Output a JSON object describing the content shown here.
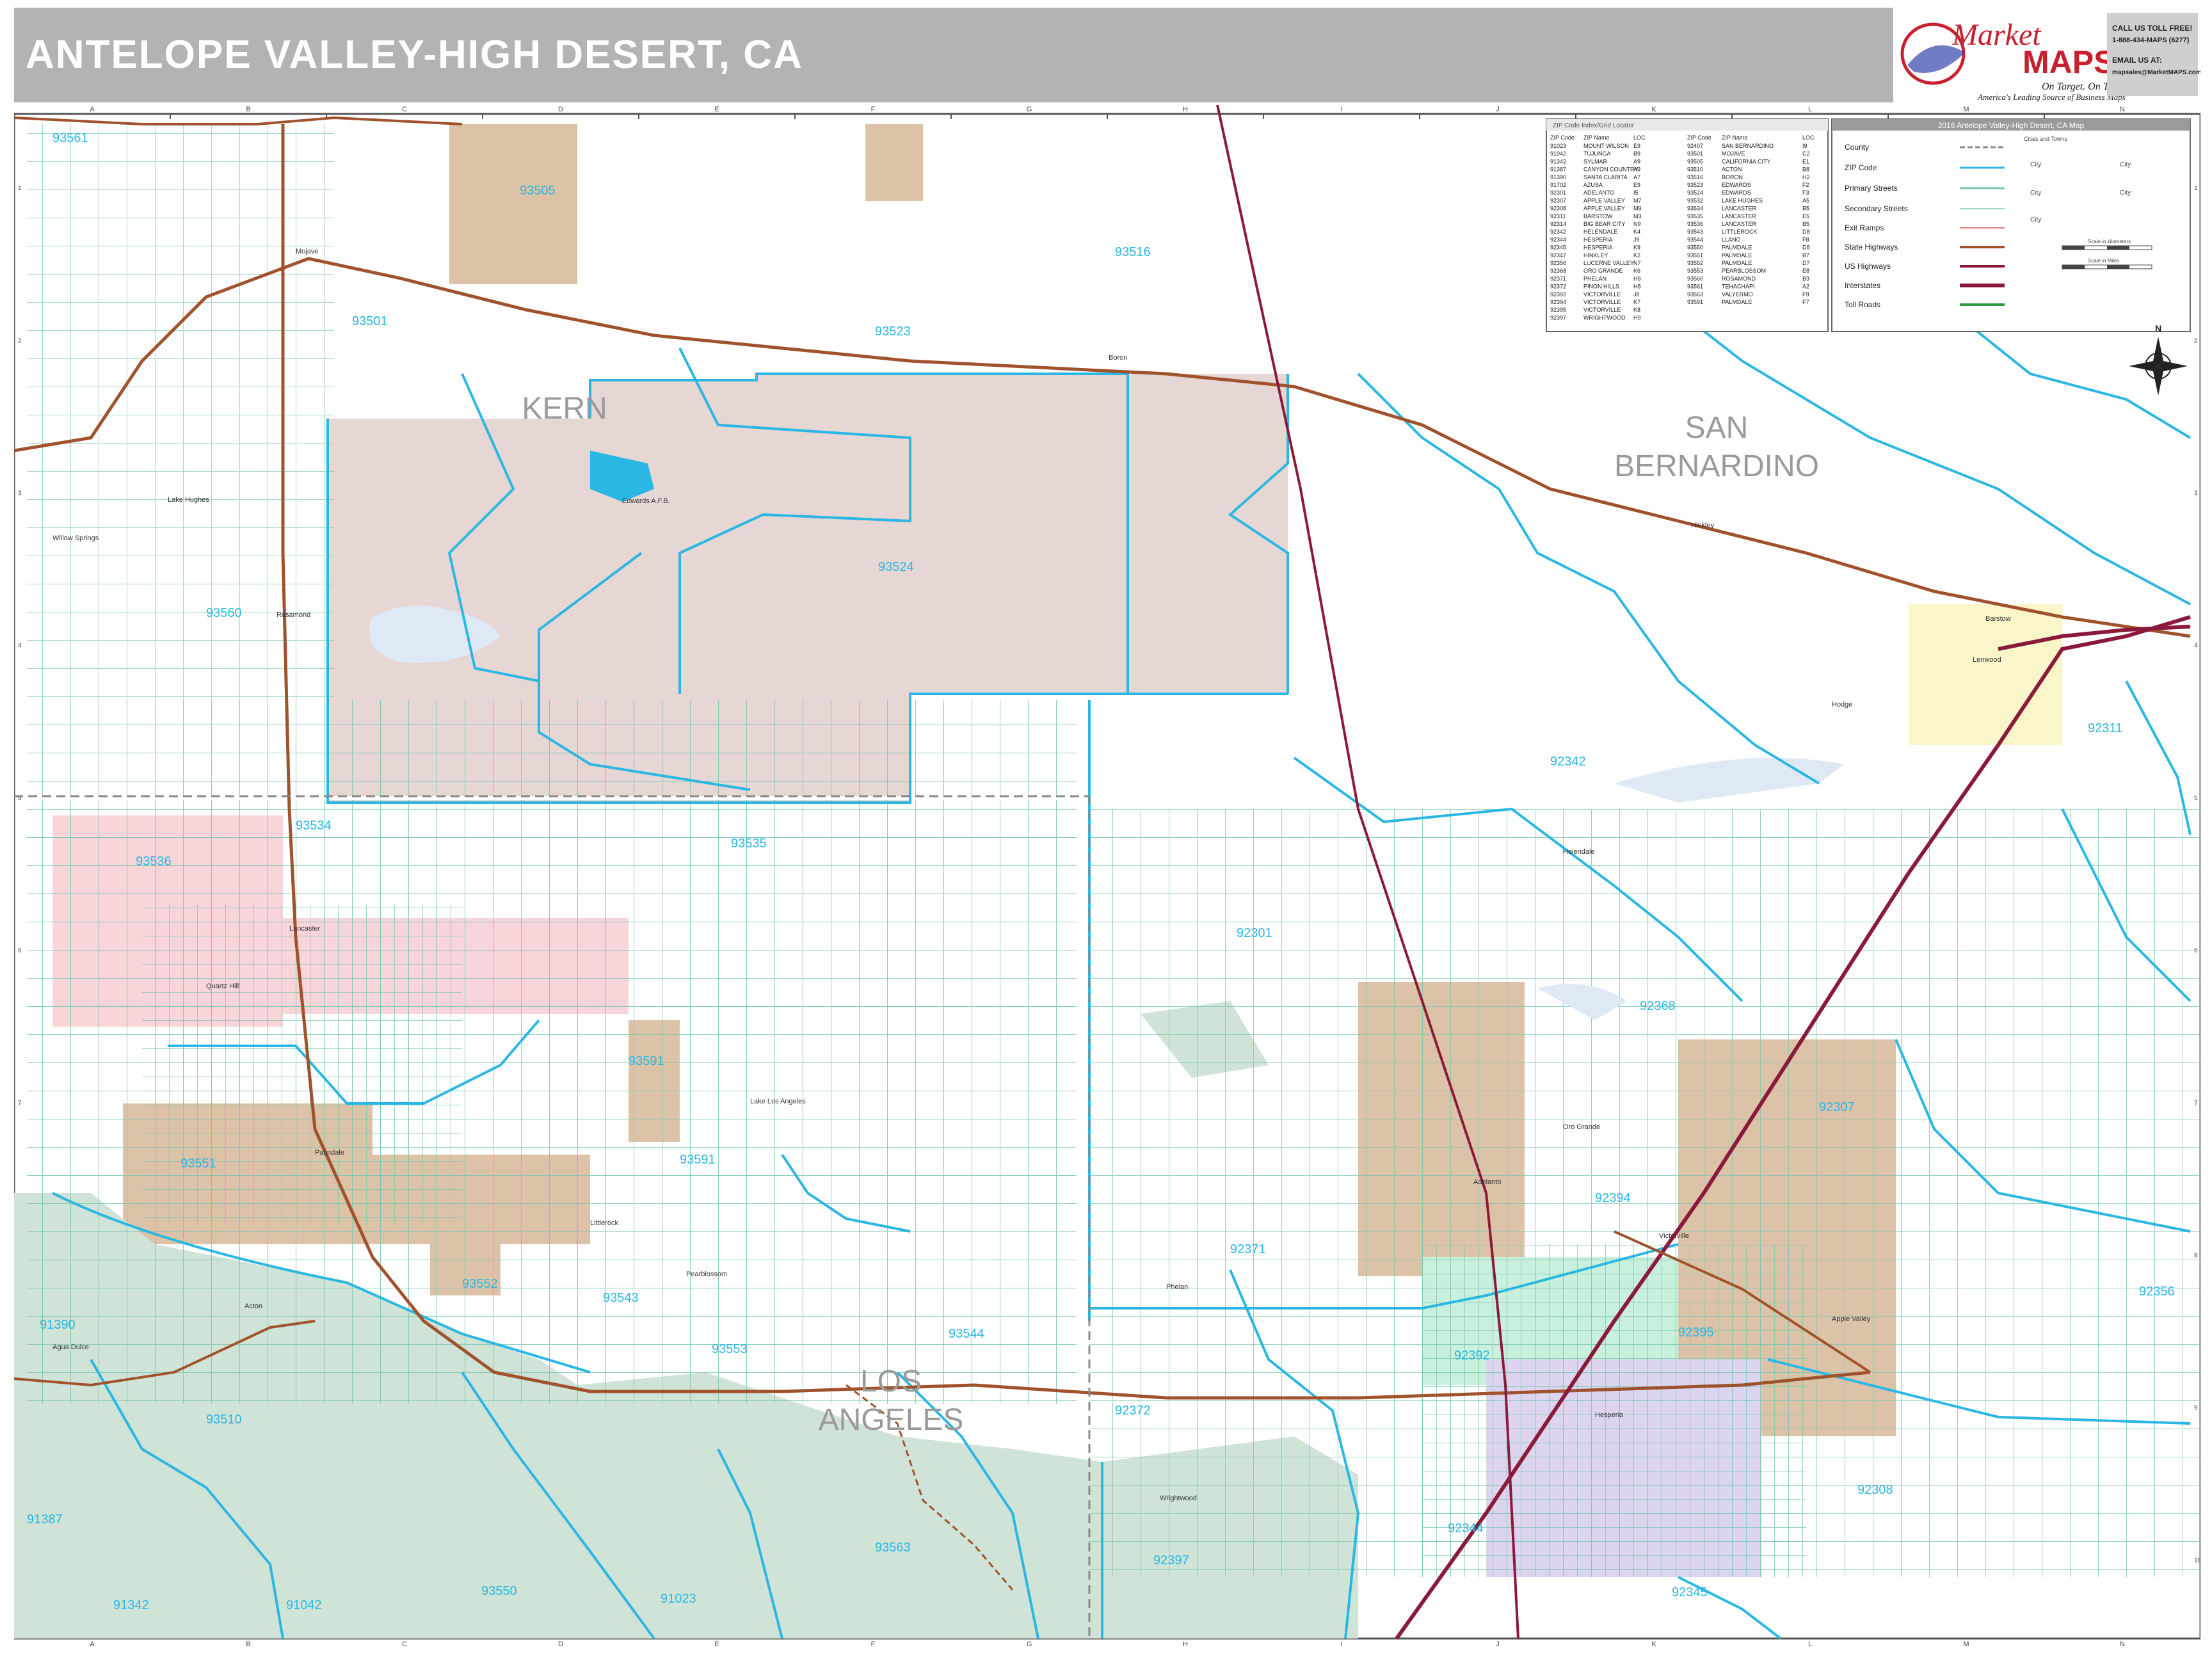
{
  "header": {
    "title": "ANTELOPE VALLEY-HIGH DESERT, CA"
  },
  "brand": {
    "logo_word1": "Market",
    "logo_word2": "MAPS",
    "tagline": "On Target. On Time.",
    "subtitle": "America's Leading Source of Business Maps",
    "call_label": "CALL US TOLL FREE!",
    "phone": "1-888-434-MAPS (6277)",
    "email_label": "EMAIL US AT:",
    "email": "mapsales@MarketMAPS.com"
  },
  "colors": {
    "zip_boundary": "#2bb7e3",
    "street": "#7cc7b2",
    "highway": "#a0522d",
    "interstate": "#8b1a3a",
    "kern_fill": "#e6d6d4",
    "lancaster_fill": "#f7d5d8",
    "tan_fill": "#dcc3a8",
    "green_fill": "#cfe3d6",
    "purple_fill": "#ddd5f0",
    "yellow_fill": "#fbf6c9",
    "mint_fill": "#c8f0dc"
  },
  "grid": {
    "cols": [
      "A",
      "B",
      "C",
      "D",
      "E",
      "F",
      "G",
      "H",
      "I",
      "J",
      "K",
      "L",
      "M",
      "N"
    ],
    "rows": [
      "1",
      "2",
      "3",
      "4",
      "5",
      "6",
      "7",
      "8",
      "9",
      "10"
    ]
  },
  "zip_index": {
    "title": "ZIP Code Index/Grid Locator",
    "headers": [
      "ZIP Code",
      "ZIP Name",
      "LOC",
      "ZIP Code",
      "ZIP Name",
      "LOC"
    ],
    "rows": [
      [
        "91023",
        "MOUNT WILSON",
        "E9",
        "92407",
        "SAN BERNARDINO",
        "I9"
      ],
      [
        "91042",
        "TUJUNGA",
        "B9",
        "93501",
        "MOJAVE",
        "C2"
      ],
      [
        "91342",
        "SYLMAR",
        "A9",
        "93505",
        "CALIFORNIA CITY",
        "E1"
      ],
      [
        "91387",
        "CANYON COUNTRY",
        "A9",
        "93510",
        "ACTON",
        "B8"
      ],
      [
        "91390",
        "SANTA CLARITA",
        "A7",
        "93516",
        "BORON",
        "H2"
      ],
      [
        "91702",
        "AZUSA",
        "E9",
        "93523",
        "EDWARDS",
        "F2"
      ],
      [
        "92301",
        "ADELANTO",
        "I5",
        "93524",
        "EDWARDS",
        "F3"
      ],
      [
        "92307",
        "APPLE VALLEY",
        "M7",
        "93532",
        "LAKE HUGHES",
        "A5"
      ],
      [
        "92308",
        "APPLE VALLEY",
        "M9",
        "93534",
        "LANCASTER",
        "B5"
      ],
      [
        "92311",
        "BARSTOW",
        "M3",
        "93535",
        "LANCASTER",
        "E5"
      ],
      [
        "92314",
        "BIG BEAR CITY",
        "N9",
        "93536",
        "LANCASTER",
        "B5"
      ],
      [
        "92342",
        "HELENDALE",
        "K4",
        "93543",
        "LITTLEROCK",
        "D8"
      ],
      [
        "92344",
        "HESPERIA",
        "J9",
        "93544",
        "LLANO",
        "F8"
      ],
      [
        "92345",
        "HESPERIA",
        "K9",
        "93550",
        "PALMDALE",
        "D8"
      ],
      [
        "92347",
        "HINKLEY",
        "K2",
        "93551",
        "PALMDALE",
        "B7"
      ],
      [
        "92356",
        "LUCERNE VALLEY",
        "N7",
        "93552",
        "PALMDALE",
        "D7"
      ],
      [
        "92368",
        "ORO GRANDE",
        "K6",
        "93553",
        "PEARBLOSSOM",
        "E8"
      ],
      [
        "92371",
        "PHELAN",
        "H8",
        "93560",
        "ROSAMOND",
        "B3"
      ],
      [
        "92372",
        "PINON HILLS",
        "H8",
        "93561",
        "TEHACHAPI",
        "A2"
      ],
      [
        "92392",
        "VICTORVILLE",
        "J8",
        "93563",
        "VALYERMO",
        "F9"
      ],
      [
        "92394",
        "VICTORVILLE",
        "K7",
        "93591",
        "PALMDALE",
        "F7"
      ],
      [
        "92395",
        "VICTORVILLE",
        "K8",
        "",
        "",
        " "
      ],
      [
        "92397",
        "WRIGHTWOOD",
        "H9",
        "",
        "",
        ""
      ]
    ]
  },
  "legend": {
    "title": "2016 Antelope Valley-High Desert, CA Map",
    "items": [
      "County",
      "ZIP Code",
      "Primary Streets",
      "Secondary Streets",
      "Exit Ramps",
      "State Highways",
      "US Highways",
      "Interstates",
      "Toll Roads"
    ],
    "cities_title": "Cities and Towns",
    "city_word": "City",
    "scale_km": "Scale in kilometers",
    "scale_mi": "Scale in Miles",
    "north": "N"
  },
  "counties": [
    {
      "name": "KERN"
    },
    {
      "name": "SAN"
    },
    {
      "name": "BERNARDINO"
    },
    {
      "name": "LOS"
    },
    {
      "name": "ANGELES"
    }
  ],
  "zip_labels": [
    "93561",
    "93505",
    "93516",
    "93501",
    "93523",
    "93524",
    "93560",
    "93534",
    "93536",
    "93535",
    "92342",
    "92301",
    "92368",
    "93591",
    "93551",
    "93591",
    "92371",
    "93552",
    "93543",
    "93553",
    "93544",
    "93510",
    "92372",
    "91390",
    "91387",
    "91342",
    "91042",
    "91023",
    "93563",
    "93550",
    "92397",
    "92344",
    "92345",
    "92392",
    "92394",
    "92395",
    "92307",
    "92308",
    "92356",
    "92311"
  ],
  "places": [
    "Edwards A.F.B.",
    "Lancaster",
    "Palmdale",
    "Rosamond",
    "Mojave",
    "Victorville",
    "Apple Valley",
    "Hesperia",
    "Adelanto",
    "Barstow",
    "Lake Los Angeles",
    "Littlerock",
    "Pearblossom",
    "Wrightwood",
    "Phelan",
    "Helendale",
    "Oro Grande",
    "Hinkley",
    "Boron",
    "Lenwood",
    "Quartz Hill",
    "Acton",
    "Agua Dulce",
    "Lake Hughes",
    "Willow Springs",
    "Hodge"
  ]
}
